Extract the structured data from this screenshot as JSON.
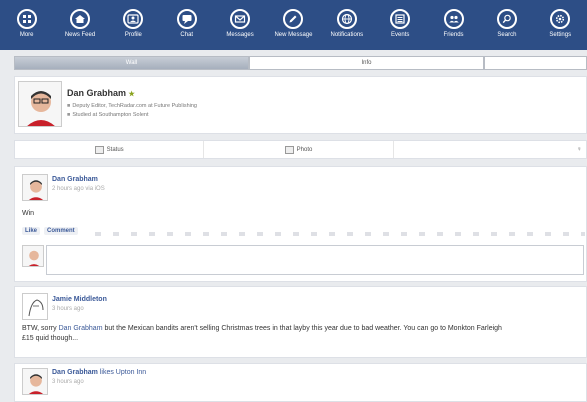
{
  "nav": [
    {
      "label": "More",
      "icon": "grid-icon"
    },
    {
      "label": "News Feed",
      "icon": "home-icon"
    },
    {
      "label": "Profile",
      "icon": "profile-icon"
    },
    {
      "label": "Chat",
      "icon": "chat-icon"
    },
    {
      "label": "Messages",
      "icon": "mail-icon"
    },
    {
      "label": "New Message",
      "icon": "pencil-icon"
    },
    {
      "label": "Notifications",
      "icon": "globe-icon"
    },
    {
      "label": "Events",
      "icon": "calendar-icon"
    },
    {
      "label": "Friends",
      "icon": "friends-icon"
    },
    {
      "label": "Search",
      "icon": "search-icon"
    },
    {
      "label": "Settings",
      "icon": "gear-icon"
    }
  ],
  "tabs": {
    "wall": "Wall",
    "info": "Info"
  },
  "profile": {
    "name": "Dan Grabham",
    "line1": "Deputy Editor, TechRadar.com at Future Publishing",
    "line2": "Studied at Southampton Solent"
  },
  "composer": {
    "status": "Status",
    "photo": "Photo"
  },
  "posts": [
    {
      "author": "Dan Grabham",
      "meta": "2 hours ago via iOS",
      "text": "Win",
      "like": "Like",
      "comment": "Comment"
    },
    {
      "author": "Jamie Middleton",
      "meta": "3 hours ago",
      "text_pre": "BTW, sorry ",
      "mention": "Dan Grabham",
      "text_post": " but the Mexican bandits aren't selling Christmas trees in that layby this year due to bad weather. You can go to Monkton Farleigh",
      "text_line2": "£15 quid though..."
    },
    {
      "author": "Dan Grabham",
      "action": "likes Upton Inn",
      "meta": "3 hours ago"
    }
  ]
}
